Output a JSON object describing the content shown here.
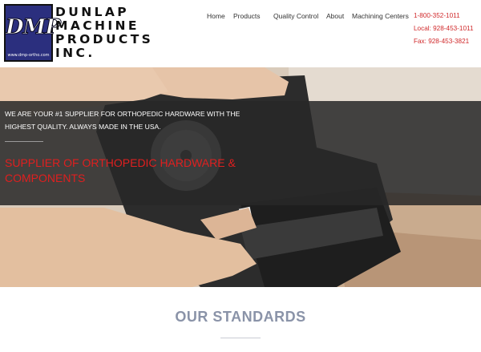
{
  "logo": {
    "badge_text": "DMP",
    "badge_url": "www.dmp-ortho.com",
    "wordmark": [
      "DUNLAP",
      "MACHINE",
      "PRODUCTS",
      "INC."
    ]
  },
  "nav": {
    "items": [
      {
        "label": "Home"
      },
      {
        "label": "Products"
      },
      {
        "label": "Quality Control"
      },
      {
        "label": "About"
      },
      {
        "label": "Machining Centers"
      }
    ]
  },
  "contact": {
    "toll_free": "1-800-352-1011",
    "local": "Local: 928-453-1011",
    "fax": "Fax: 928-453-3821"
  },
  "hero": {
    "tagline": "WE ARE YOUR #1 SUPPLIER FOR ORTHOPEDIC HARDWARE WITH THE HIGHEST QUALITY. ALWAYS MADE IN THE USA.",
    "headline": "SUPPLIER OF ORTHOPEDIC HARDWARE & COMPONENTS"
  },
  "standards": {
    "title": "OUR STANDARDS"
  },
  "colors": {
    "accent_red": "#d0282a",
    "logo_blue": "#2b2f7e",
    "overlay": "#282828"
  }
}
